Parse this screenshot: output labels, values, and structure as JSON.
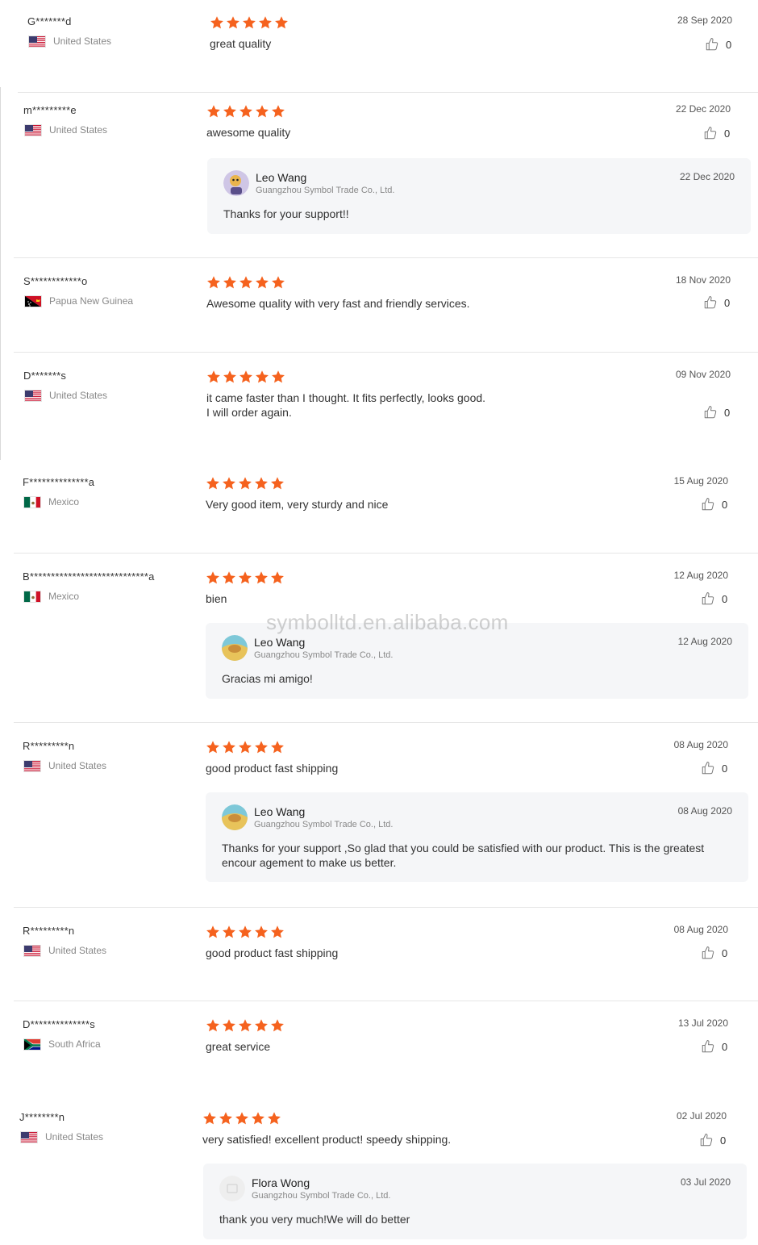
{
  "watermark": "symbolltd.en.alibaba.com",
  "colors": {
    "star": "#f5621e",
    "reply_bg": "#f5f6f8",
    "divider": "#e5e5e5"
  },
  "icons": {
    "star": "star-icon",
    "like": "thumbs-up-icon"
  },
  "reviews": [
    {
      "buyer": "G*******d",
      "country": "United States",
      "flag": "us",
      "rating": 5,
      "text": "great quality",
      "date": "28 Sep 2020",
      "likes": "0"
    },
    {
      "buyer": "m*********e",
      "country": "United States",
      "flag": "us",
      "rating": 5,
      "text": "awesome quality",
      "date": "22 Dec 2020",
      "likes": "0",
      "reply": {
        "name": "Leo Wang",
        "company": "Guangzhou Symbol Trade Co., Ltd.",
        "date": "22 Dec 2020",
        "text": "Thanks for your support!!"
      }
    },
    {
      "buyer": "S************o",
      "country": "Papua New Guinea",
      "flag": "pg",
      "rating": 5,
      "text": "Awesome quality with very fast and friendly services.",
      "date": "18 Nov 2020",
      "likes": "0"
    },
    {
      "buyer": "D*******s",
      "country": "United States",
      "flag": "us",
      "rating": 5,
      "text": "it came faster than I thought. It fits perfectly, looks good.\nI will order again.",
      "date": "09 Nov 2020",
      "likes": "0"
    },
    {
      "buyer": "F**************a",
      "country": "Mexico",
      "flag": "mx",
      "rating": 5,
      "text": "Very good item, very sturdy and nice",
      "date": "15 Aug 2020",
      "likes": "0"
    },
    {
      "buyer": "B****************************a",
      "country": "Mexico",
      "flag": "mx",
      "rating": 5,
      "text": "bien",
      "date": "12 Aug 2020",
      "likes": "0",
      "reply": {
        "name": "Leo Wang",
        "company": "Guangzhou Symbol Trade Co., Ltd.",
        "date": "12 Aug 2020",
        "text": "Gracias mi amigo!"
      }
    },
    {
      "buyer": "R*********n",
      "country": "United States",
      "flag": "us",
      "rating": 5,
      "text": "good product fast shipping",
      "date": "08 Aug 2020",
      "likes": "0",
      "reply": {
        "name": "Leo Wang",
        "company": "Guangzhou Symbol Trade Co., Ltd.",
        "date": "08 Aug 2020",
        "text": "Thanks for your support ,So glad that you could be satisfied with our product. This is the greatest encour agement to make us better."
      }
    },
    {
      "buyer": "R*********n",
      "country": "United States",
      "flag": "us",
      "rating": 5,
      "text": "good product fast shipping",
      "date": "08 Aug 2020",
      "likes": "0"
    },
    {
      "buyer": "D**************s",
      "country": "South Africa",
      "flag": "za",
      "rating": 5,
      "text": "great service",
      "date": "13 Jul 2020",
      "likes": "0"
    },
    {
      "buyer": "J********n",
      "country": "United States",
      "flag": "us",
      "rating": 5,
      "text": "very satisfied! excellent product! speedy shipping.",
      "date": "02 Jul 2020",
      "likes": "0",
      "reply": {
        "name": "Flora Wong",
        "company": "Guangzhou Symbol Trade Co., Ltd.",
        "date": "03 Jul 2020",
        "text": "thank you very much!We will do better"
      }
    }
  ]
}
